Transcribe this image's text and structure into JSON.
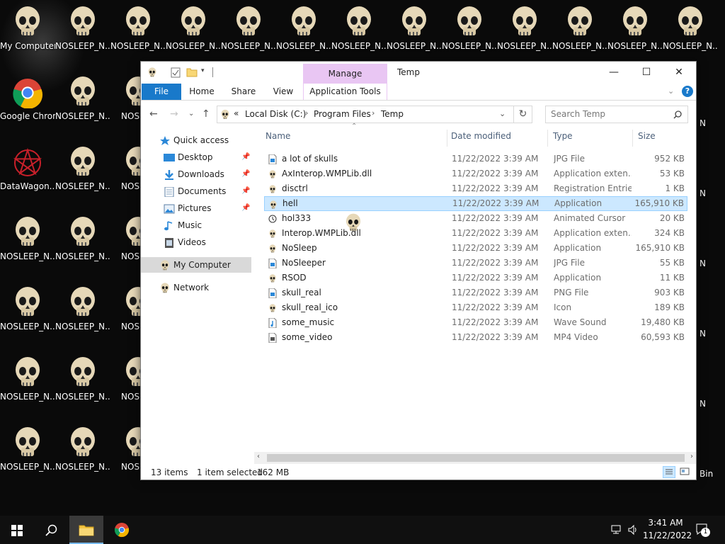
{
  "desktop": {
    "icons_left": [
      {
        "label": "My Computer",
        "icon": "skull-icon"
      },
      {
        "label": "Google Chrome",
        "icon": "chrome-icon"
      },
      {
        "label": "DataWagon...",
        "icon": "pentagram-icon"
      }
    ],
    "nosleep_label": "NOSLEEP_N...",
    "nosleep_short_label": "NOSLEE",
    "nosleep_right_label": "N",
    "recycle_bin_label": "Bin"
  },
  "window": {
    "title": "Temp",
    "context_tab": "Manage",
    "context_subtab": "Application Tools",
    "ribbon_tabs": [
      "File",
      "Home",
      "Share",
      "View"
    ],
    "minimize": "—",
    "maximize": "☐",
    "close": "✕",
    "help": "?",
    "address": {
      "overflow": "«",
      "crumbs": [
        "Local Disk (C:)",
        "Program Files",
        "Temp"
      ]
    },
    "search_placeholder": "Search Temp",
    "nav": [
      {
        "label": "Quick access",
        "icon": "star-icon",
        "pinned": false
      },
      {
        "label": "Desktop",
        "icon": "desktop-folder-icon",
        "pinned": true
      },
      {
        "label": "Downloads",
        "icon": "downloads-icon",
        "pinned": true
      },
      {
        "label": "Documents",
        "icon": "documents-icon",
        "pinned": true
      },
      {
        "label": "Pictures",
        "icon": "pictures-icon",
        "pinned": true
      },
      {
        "label": "Music",
        "icon": "music-icon",
        "pinned": false
      },
      {
        "label": "Videos",
        "icon": "videos-icon",
        "pinned": false
      },
      {
        "label": "My Computer",
        "icon": "skull-icon",
        "pinned": false
      },
      {
        "label": "Network",
        "icon": "skull-icon",
        "pinned": false
      }
    ],
    "columns": {
      "name": "Name",
      "date": "Date modified",
      "type": "Type",
      "size": "Size"
    },
    "files": [
      {
        "name": "a lot of skulls",
        "date": "11/22/2022 3:39 AM",
        "type": "JPG File",
        "size": "952 KB",
        "icon": "image-file-icon"
      },
      {
        "name": "AxInterop.WMPLib.dll",
        "date": "11/22/2022 3:39 AM",
        "type": "Application exten...",
        "size": "53 KB",
        "icon": "skull-icon"
      },
      {
        "name": "disctrl",
        "date": "11/22/2022 3:39 AM",
        "type": "Registration Entries",
        "size": "1 KB",
        "icon": "skull-icon"
      },
      {
        "name": "hell",
        "date": "11/22/2022 3:39 AM",
        "type": "Application",
        "size": "165,910 KB",
        "icon": "skull-icon"
      },
      {
        "name": "hol333",
        "date": "11/22/2022 3:39 AM",
        "type": "Animated Cursor",
        "size": "20 KB",
        "icon": "cursor-file-icon"
      },
      {
        "name": "Interop.WMPLib.dll",
        "date": "11/22/2022 3:39 AM",
        "type": "Application exten...",
        "size": "324 KB",
        "icon": "skull-icon"
      },
      {
        "name": "NoSleep",
        "date": "11/22/2022 3:39 AM",
        "type": "Application",
        "size": "165,910 KB",
        "icon": "skull-icon"
      },
      {
        "name": "NoSleeper",
        "date": "11/22/2022 3:39 AM",
        "type": "JPG File",
        "size": "55 KB",
        "icon": "image-file-icon"
      },
      {
        "name": "RSOD",
        "date": "11/22/2022 3:39 AM",
        "type": "Application",
        "size": "11 KB",
        "icon": "skull-icon"
      },
      {
        "name": "skull_real",
        "date": "11/22/2022 3:39 AM",
        "type": "PNG File",
        "size": "903 KB",
        "icon": "image-file-icon"
      },
      {
        "name": "skull_real_ico",
        "date": "11/22/2022 3:39 AM",
        "type": "Icon",
        "size": "189 KB",
        "icon": "skull-icon"
      },
      {
        "name": "some_music",
        "date": "11/22/2022 3:39 AM",
        "type": "Wave Sound",
        "size": "19,480 KB",
        "icon": "music-file-icon"
      },
      {
        "name": "some_video",
        "date": "11/22/2022 3:39 AM",
        "type": "MP4 Video",
        "size": "60,593 KB",
        "icon": "video-file-icon"
      }
    ],
    "selected_file": "hell",
    "status": {
      "count": "13 items",
      "selection": "1 item selected",
      "size": "162 MB"
    }
  },
  "taskbar": {
    "time": "3:41 AM",
    "date": "11/22/2022",
    "notification_count": "1"
  },
  "colors": {
    "file_tab": "#1979ca",
    "context_tab": "#e9c6f3",
    "selection": "#cce8ff",
    "selection_border": "#99d1ff"
  }
}
